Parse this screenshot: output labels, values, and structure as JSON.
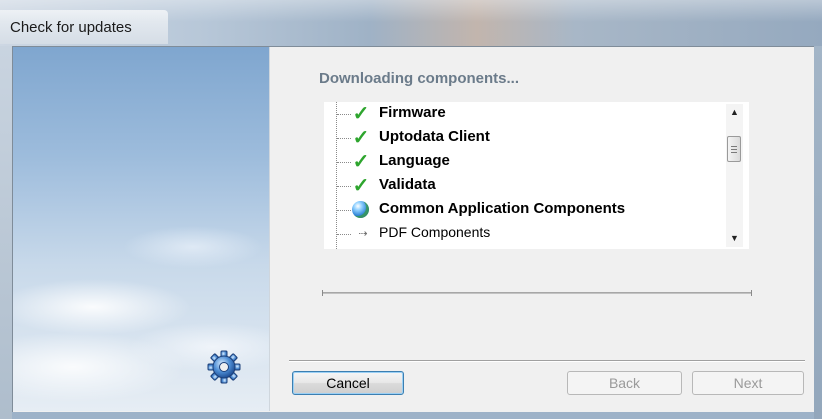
{
  "window": {
    "title": "Check for updates"
  },
  "main": {
    "heading": "Downloading components...",
    "components": [
      {
        "label": "Firmware",
        "status": "done",
        "icon": "check-icon",
        "weight": "bold"
      },
      {
        "label": "Uptodata Client",
        "status": "done",
        "icon": "check-icon",
        "weight": "bold"
      },
      {
        "label": "Language",
        "status": "done",
        "icon": "check-icon",
        "weight": "bold"
      },
      {
        "label": "Validata",
        "status": "done",
        "icon": "check-icon",
        "weight": "bold"
      },
      {
        "label": "Common Application Components",
        "status": "in-progress",
        "icon": "globe-icon",
        "weight": "bold"
      },
      {
        "label": "PDF Components",
        "status": "pending",
        "icon": "arrow-icon",
        "weight": "normal"
      }
    ]
  },
  "buttons": {
    "cancel": "Cancel",
    "back": "Back",
    "next": "Next"
  },
  "colors": {
    "check": "#2ea52e",
    "heading": "#6b7b8a",
    "client_bg": "#f0f0f0"
  }
}
